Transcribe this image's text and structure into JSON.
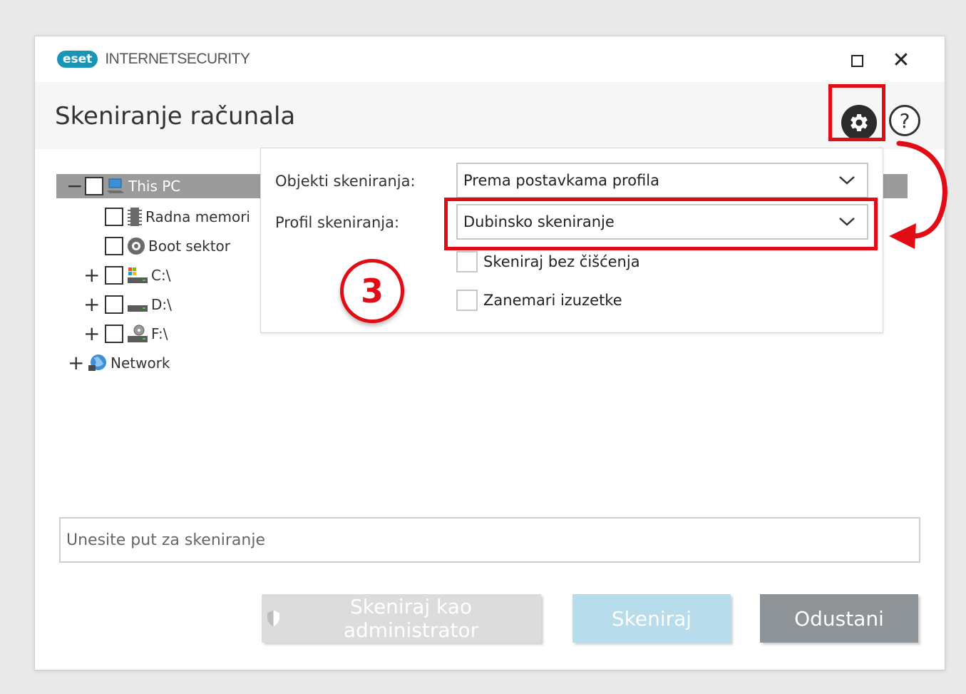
{
  "app": {
    "logo_text": "eset",
    "product_name": "INTERNETSECURITY",
    "title": "Skeniranje računala"
  },
  "tree": {
    "items": [
      {
        "label": "This PC",
        "expander": "−"
      },
      {
        "label": "Radna memori",
        "expander": ""
      },
      {
        "label": "Boot sektor",
        "expander": ""
      },
      {
        "label": "C:\\",
        "expander": "+"
      },
      {
        "label": "D:\\",
        "expander": "+"
      },
      {
        "label": "F:\\",
        "expander": "+"
      },
      {
        "label": "Network",
        "expander": "+"
      }
    ]
  },
  "scan_settings": {
    "targets_label": "Objekti skeniranja:",
    "targets_value": "Prema postavkama profila",
    "profile_label": "Profil skeniranja:",
    "profile_value": "Dubinsko skeniranje",
    "options": [
      {
        "label": "Skeniraj bez čišćenja",
        "checked": false
      },
      {
        "label": "Zanemari izuzetke",
        "checked": false
      }
    ]
  },
  "annotation": {
    "step_number": "3",
    "highlight_color": "#e10c16"
  },
  "path_input": {
    "placeholder": "Unesite put za skeniranje"
  },
  "buttons": {
    "admin_label": "Skeniraj kao administrator",
    "scan_label": "Skeniraj",
    "cancel_label": "Odustani"
  },
  "icons": {
    "settings": "gear-icon",
    "help": "help-icon",
    "maximize": "maximize-icon",
    "close": "close-icon",
    "help_glyph": "?",
    "close_glyph": "✕"
  },
  "colors": {
    "brand": "#1a95b8",
    "selected_row": "#9b9b9b",
    "scan_button": "#b7dcec",
    "cancel_button": "#8d9397"
  }
}
